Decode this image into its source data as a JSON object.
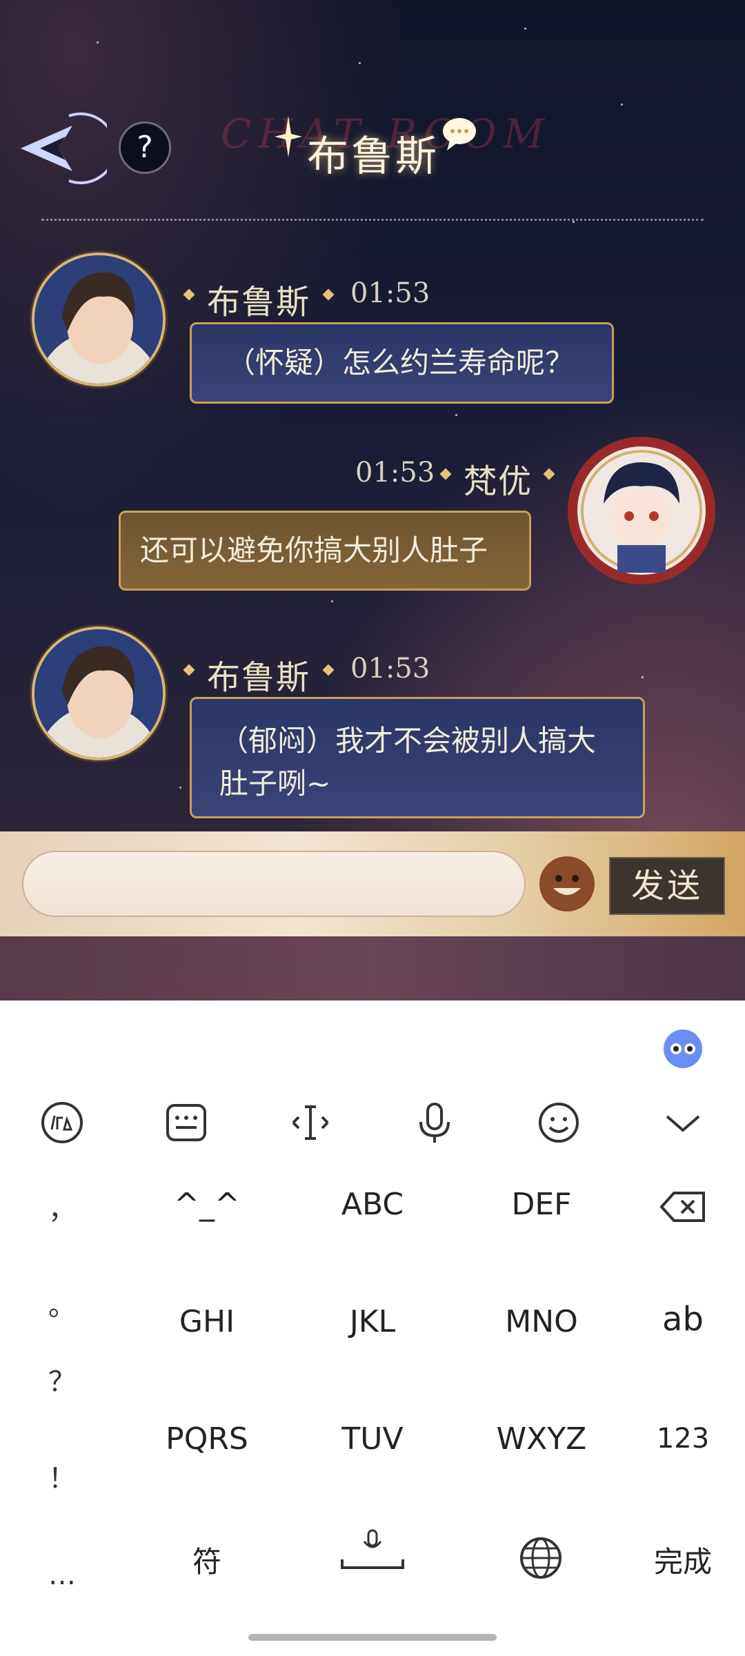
{
  "header": {
    "title": "布鲁斯",
    "ghost_text": "CHAT ROOM",
    "help_label": "?"
  },
  "messages": [
    {
      "sender": "布鲁斯",
      "time": "01:53",
      "text": "（怀疑）怎么约兰寿命呢？",
      "side": "left"
    },
    {
      "sender": "梵优",
      "time": "01:53",
      "text": "还可以避免你搞大别人肚子",
      "side": "right"
    },
    {
      "sender": "布鲁斯",
      "time": "01:53",
      "text_line1": "（郁闷）我才不会被别人搞大",
      "text_line2": "肚子咧~",
      "side": "left"
    }
  ],
  "input": {
    "value": "",
    "send_label": "发送"
  },
  "keyboard": {
    "toolbar": [
      "handwriting-icon",
      "keyboard-icon",
      "cursor-icon",
      "microphone-icon",
      "emoji-icon",
      "chevron-down-icon"
    ],
    "side_keys": [
      "，",
      "。",
      "？",
      "！",
      "…"
    ],
    "row1": [
      "^_^",
      "ABC",
      "DEF"
    ],
    "row2": [
      "GHI",
      "JKL",
      "MNO",
      "ab"
    ],
    "row3": [
      "PQRS",
      "TUV",
      "WXYZ",
      "123"
    ],
    "row4": {
      "symbol": "符",
      "done": "完成"
    }
  }
}
